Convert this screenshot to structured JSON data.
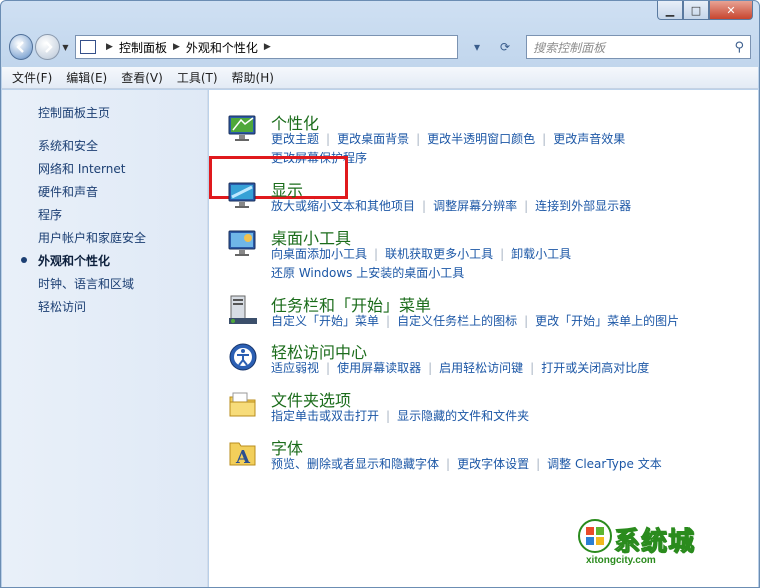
{
  "window": {
    "caption": {
      "minimize": "▁",
      "maximize": "□",
      "close": "✕"
    }
  },
  "nav": {
    "back_icon": "back-arrow-icon",
    "forward_icon": "forward-arrow-icon",
    "breadcrumb": [
      "控制面板",
      "外观和个性化"
    ],
    "search_placeholder": "搜索控制面板"
  },
  "menubar": [
    "文件(F)",
    "编辑(E)",
    "查看(V)",
    "工具(T)",
    "帮助(H)"
  ],
  "sidebar": {
    "items": [
      {
        "label": "控制面板主页",
        "current": false
      },
      {
        "label": "系统和安全",
        "current": false
      },
      {
        "label": "网络和 Internet",
        "current": false
      },
      {
        "label": "硬件和声音",
        "current": false
      },
      {
        "label": "程序",
        "current": false
      },
      {
        "label": "用户帐户和家庭安全",
        "current": false
      },
      {
        "label": "外观和个性化",
        "current": true
      },
      {
        "label": "时钟、语言和区域",
        "current": false
      },
      {
        "label": "轻松访问",
        "current": false
      }
    ]
  },
  "categories": [
    {
      "title": "个性化",
      "icon": "personalization-icon",
      "links": [
        "更改主题",
        "更改桌面背景",
        "更改半透明窗口颜色",
        "更改声音效果",
        "更改屏幕保护程序"
      ]
    },
    {
      "title": "显示",
      "icon": "display-icon",
      "links": [
        "放大或缩小文本和其他项目",
        "调整屏幕分辨率",
        "连接到外部显示器"
      ]
    },
    {
      "title": "桌面小工具",
      "icon": "gadgets-icon",
      "links": [
        "向桌面添加小工具",
        "联机获取更多小工具",
        "卸载小工具",
        "还原 Windows 上安装的桌面小工具"
      ]
    },
    {
      "title": "任务栏和「开始」菜单",
      "icon": "taskbar-icon",
      "links": [
        "自定义「开始」菜单",
        "自定义任务栏上的图标",
        "更改「开始」菜单上的图片"
      ]
    },
    {
      "title": "轻松访问中心",
      "icon": "ease-of-access-icon",
      "links": [
        "适应弱视",
        "使用屏幕读取器",
        "启用轻松访问键",
        "打开或关闭高对比度"
      ]
    },
    {
      "title": "文件夹选项",
      "icon": "folder-options-icon",
      "links": [
        "指定单击或双击打开",
        "显示隐藏的文件和文件夹"
      ]
    },
    {
      "title": "字体",
      "icon": "fonts-icon",
      "links": [
        "预览、删除或者显示和隐藏字体",
        "更改字体设置",
        "调整 ClearType 文本"
      ]
    }
  ],
  "watermark": {
    "text": "系统城",
    "url": "xitongcity.com"
  },
  "colors": {
    "highlight": "#e0191d",
    "category_title": "#1b6c1b",
    "link": "#1c57a6"
  }
}
